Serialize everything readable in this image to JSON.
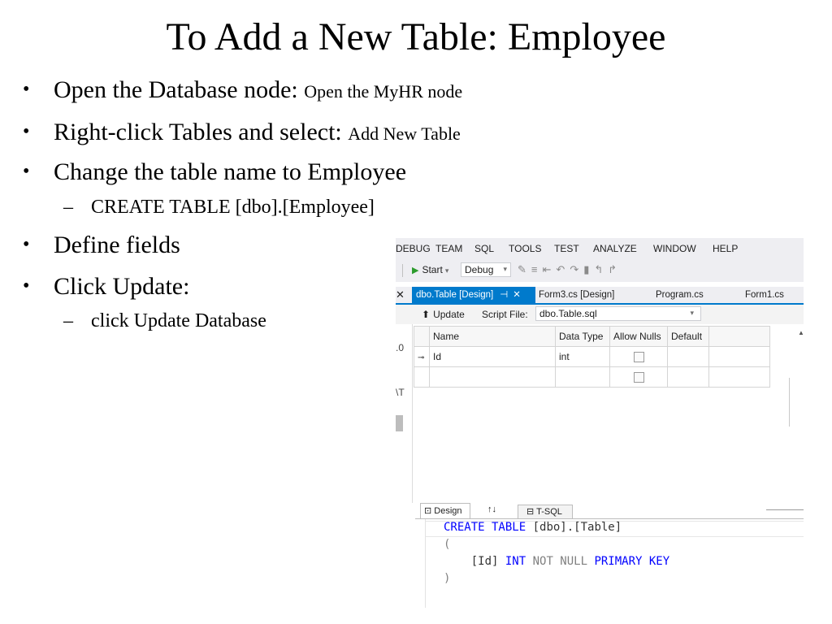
{
  "slide": {
    "title": "To Add a New Table: Employee",
    "bullets": [
      {
        "text": "Open the Database node:",
        "detail": "Open the MyHR node"
      },
      {
        "text": "Right-click Tables and select:",
        "detail": "Add New Table"
      },
      {
        "text": "Change the table name to Employee"
      },
      {
        "text": "Define fields"
      },
      {
        "text": "Click Update:"
      }
    ],
    "subbullets": [
      "CREATE TABLE [dbo].[Employee]",
      "click Update Database"
    ]
  },
  "ide": {
    "menu": [
      "DEBUG",
      "TEAM",
      "SQL",
      "TOOLS",
      "TEST",
      "ANALYZE",
      "WINDOW",
      "HELP"
    ],
    "toolbar": {
      "start_label": "Start",
      "config_value": "Debug"
    },
    "tabs": {
      "active": "dbo.Table [Design]",
      "pin_glyph": "⊣",
      "close_glyph": "✕",
      "others": [
        "Form3.cs [Design]",
        "Program.cs",
        "Form1.cs"
      ]
    },
    "designbar": {
      "update_label": "Update",
      "script_file_label": "Script File:",
      "script_file_value": "dbo.Table.sql"
    },
    "gutter": [
      ".0",
      "\\T"
    ],
    "grid": {
      "columns": [
        "Name",
        "Data Type",
        "Allow Nulls",
        "Default"
      ],
      "rows": [
        {
          "name": "Id",
          "type": "int",
          "allow_nulls": false,
          "primary_key": true
        },
        {
          "name": "",
          "type": "",
          "allow_nulls": false,
          "primary_key": false
        }
      ]
    },
    "bottom_tabs": {
      "design": "Design",
      "swap": "↑↓",
      "tsql": "T-SQL"
    },
    "sql": {
      "l1_kw": "CREATE TABLE",
      "l1_rest": " [dbo].[Table]",
      "l2": "(",
      "l3_col": "    [Id] ",
      "l3_type": "INT",
      "l3_null": " NOT NULL ",
      "l3_pk": "PRIMARY KEY",
      "l4": ")"
    }
  }
}
